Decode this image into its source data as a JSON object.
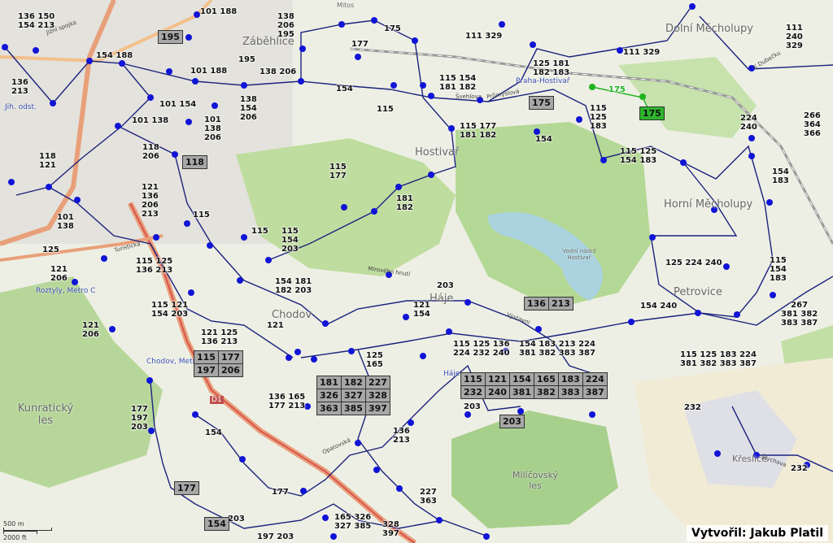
{
  "credit": "Vytvořil: Jakub Platil",
  "scale": {
    "metric": "500 m",
    "imperial": "2000 ft"
  },
  "colors": {
    "stop": "#1014d6",
    "route": "#1a237e",
    "highway": "#e8a07a",
    "highway_red": "#d9534f",
    "forest": "#a8d08d",
    "water": "#aad3df",
    "green_route": "#1db31d",
    "box": "#a7a7a7"
  },
  "places": [
    {
      "name": "Záběhlice"
    },
    {
      "name": "Hostivař"
    },
    {
      "name": "Chodov"
    },
    {
      "name": "Háje"
    },
    {
      "name": "Petrovice"
    },
    {
      "name": "Horní Měcholupy"
    },
    {
      "name": "Dolní Měcholupy"
    },
    {
      "name": "Kunratický les"
    },
    {
      "name": "Milíčovský les"
    },
    {
      "name": "Křeslice"
    },
    {
      "name": "Mitos"
    },
    {
      "name": "Vodní nádrž Hostivař"
    }
  ],
  "metro_labels": [
    {
      "name": "Roztyly, Metro C"
    },
    {
      "name": "Chodov, Metro C"
    },
    {
      "name": "Praha-Hostivař"
    },
    {
      "name": "Háje"
    },
    {
      "name": "Jih. odst."
    }
  ],
  "streets": [
    {
      "name": "Jižní spojka"
    },
    {
      "name": "Průmyslová"
    },
    {
      "name": "Švehlova"
    },
    {
      "name": "Mírového hnutí"
    },
    {
      "name": "Výstavní"
    },
    {
      "name": "Opatovská"
    },
    {
      "name": "Turistická"
    },
    {
      "name": "Štychova"
    },
    {
      "name": "D1"
    },
    {
      "name": "K Dubečku"
    }
  ],
  "labels": [
    {
      "text": "136 150\n154 213"
    },
    {
      "text": "101 188"
    },
    {
      "text": "138\n206\n195"
    },
    {
      "text": "177"
    },
    {
      "text": "175"
    },
    {
      "text": "111 329"
    },
    {
      "text": "111 329"
    },
    {
      "text": "111\n240\n329"
    },
    {
      "text": "154 188"
    },
    {
      "text": "101 188"
    },
    {
      "text": "195"
    },
    {
      "text": "138 206"
    },
    {
      "text": "125 181\n182 183"
    },
    {
      "text": "136\n213"
    },
    {
      "text": "101 154"
    },
    {
      "text": "138\n154\n206"
    },
    {
      "text": "154"
    },
    {
      "text": "115 154\n181 182"
    },
    {
      "text": "115"
    },
    {
      "text": "175",
      "green": true
    },
    {
      "text": "115\n125\n183"
    },
    {
      "text": "266\n364\n366"
    },
    {
      "text": "101 138"
    },
    {
      "text": "101\n138\n206"
    },
    {
      "text": "115 177\n181 182"
    },
    {
      "text": "224\n240"
    },
    {
      "text": "118\n121"
    },
    {
      "text": "118\n206"
    },
    {
      "text": "154"
    },
    {
      "text": "115 125\n154 183"
    },
    {
      "text": "154\n183"
    },
    {
      "text": "115\n177"
    },
    {
      "text": "121\n136\n206\n213"
    },
    {
      "text": "101\n138"
    },
    {
      "text": "181\n182"
    },
    {
      "text": "115"
    },
    {
      "text": "115"
    },
    {
      "text": "115\n154\n203"
    },
    {
      "text": "125"
    },
    {
      "text": "115 125\n136 213"
    },
    {
      "text": "125 224 240"
    },
    {
      "text": "115\n154\n183"
    },
    {
      "text": "121\n206"
    },
    {
      "text": "154 181\n182 203"
    },
    {
      "text": "203"
    },
    {
      "text": "115 121\n154 203"
    },
    {
      "text": "121\n154"
    },
    {
      "text": "154 240"
    },
    {
      "text": "267\n381 382\n383 387"
    },
    {
      "text": "121\n206"
    },
    {
      "text": "121"
    },
    {
      "text": "121 125\n136 213"
    },
    {
      "text": "115 125 136\n224 232 240"
    },
    {
      "text": "154 183 213 224\n381 382 383 387"
    },
    {
      "text": "115 125 183 224\n381 382 383 387"
    },
    {
      "text": "125\n165"
    },
    {
      "text": "136 165\n177 213"
    },
    {
      "text": "177\n197\n203"
    },
    {
      "text": "203"
    },
    {
      "text": "232"
    },
    {
      "text": "154"
    },
    {
      "text": "136\n213"
    },
    {
      "text": "227\n363"
    },
    {
      "text": "177"
    },
    {
      "text": "165 326\n327 385"
    },
    {
      "text": "328\n397"
    },
    {
      "text": "203"
    },
    {
      "text": "197 203"
    },
    {
      "text": "232"
    }
  ],
  "boxes": [
    {
      "rows": [
        [
          "195"
        ]
      ]
    },
    {
      "rows": [
        [
          "175"
        ]
      ]
    },
    {
      "rows": [
        [
          "175"
        ]
      ],
      "green": true
    },
    {
      "rows": [
        [
          "118"
        ]
      ]
    },
    {
      "rows": [
        [
          "136",
          "213"
        ]
      ]
    },
    {
      "rows": [
        [
          "115",
          "177"
        ],
        [
          "197",
          "206"
        ]
      ]
    },
    {
      "rows": [
        [
          "181",
          "182",
          "227"
        ],
        [
          "326",
          "327",
          "328"
        ],
        [
          "363",
          "385",
          "397"
        ]
      ]
    },
    {
      "rows": [
        [
          "115",
          "121",
          "154",
          "165",
          "183",
          "224"
        ],
        [
          "232",
          "240",
          "381",
          "382",
          "383",
          "387"
        ]
      ]
    },
    {
      "rows": [
        [
          "203"
        ]
      ]
    },
    {
      "rows": [
        [
          "177"
        ]
      ]
    },
    {
      "rows": [
        [
          "154"
        ]
      ]
    }
  ]
}
